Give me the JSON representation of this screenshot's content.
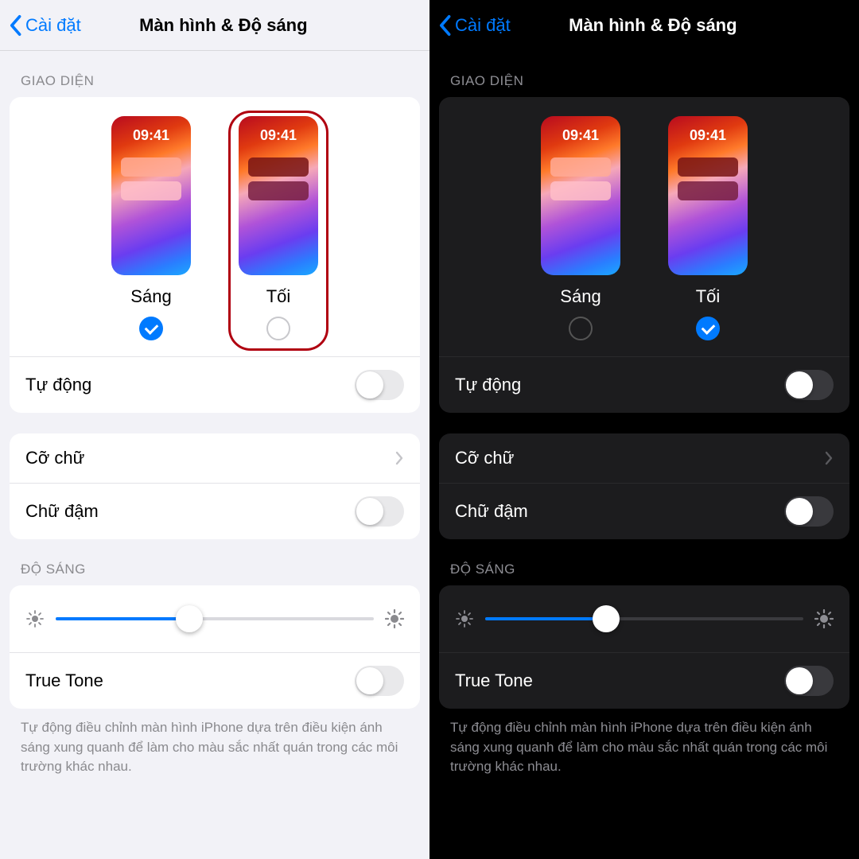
{
  "left": {
    "nav": {
      "back": "Cài đặt",
      "title": "Màn hình & Độ sáng"
    },
    "appearance": {
      "header": "GIAO DIỆN",
      "light": {
        "label": "Sáng",
        "clock": "09:41",
        "selected": true
      },
      "dark": {
        "label": "Tối",
        "clock": "09:41",
        "selected": false,
        "highlighted": true
      },
      "auto_label": "Tự động",
      "auto_on": false
    },
    "text": {
      "size_label": "Cỡ chữ",
      "bold_label": "Chữ đậm",
      "bold_on": false
    },
    "brightness": {
      "header": "ĐỘ SÁNG",
      "value_percent": 42,
      "truetone_label": "True Tone",
      "truetone_on": false,
      "footer": "Tự động điều chỉnh màn hình iPhone dựa trên điều kiện ánh sáng xung quanh để làm cho màu sắc nhất quán trong các môi trường khác nhau."
    }
  },
  "right": {
    "nav": {
      "back": "Cài đặt",
      "title": "Màn hình & Độ sáng"
    },
    "appearance": {
      "header": "GIAO DIỆN",
      "light": {
        "label": "Sáng",
        "clock": "09:41",
        "selected": false
      },
      "dark": {
        "label": "Tối",
        "clock": "09:41",
        "selected": true
      },
      "auto_label": "Tự động",
      "auto_on": false
    },
    "text": {
      "size_label": "Cỡ chữ",
      "bold_label": "Chữ đậm",
      "bold_on": false
    },
    "brightness": {
      "header": "ĐỘ SÁNG",
      "value_percent": 38,
      "truetone_label": "True Tone",
      "truetone_on": false,
      "footer": "Tự động điều chỉnh màn hình iPhone dựa trên điều kiện ánh sáng xung quanh để làm cho màu sắc nhất quán trong các môi trường khác nhau."
    }
  }
}
